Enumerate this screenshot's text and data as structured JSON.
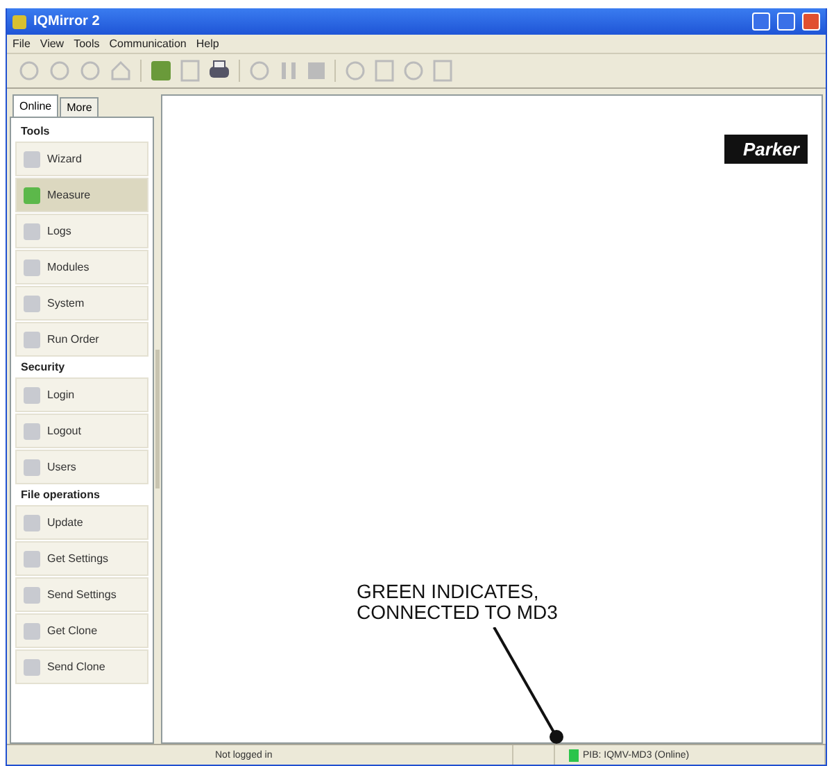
{
  "window": {
    "title": "IQMirror 2"
  },
  "menu": [
    "File",
    "View",
    "Tools",
    "Communication",
    "Help"
  ],
  "toolbar": [
    {
      "kind": "circle",
      "enabled": false
    },
    {
      "kind": "circle",
      "enabled": false
    },
    {
      "kind": "circle",
      "enabled": false
    },
    {
      "kind": "house",
      "enabled": false
    },
    {
      "kind": "sep"
    },
    {
      "kind": "chip",
      "enabled": true
    },
    {
      "kind": "page",
      "enabled": false
    },
    {
      "kind": "printer",
      "enabled": true
    },
    {
      "kind": "sep"
    },
    {
      "kind": "circle",
      "enabled": false
    },
    {
      "kind": "bars",
      "enabled": false
    },
    {
      "kind": "block",
      "enabled": false
    },
    {
      "kind": "sep"
    },
    {
      "kind": "circle",
      "enabled": false
    },
    {
      "kind": "page",
      "enabled": false
    },
    {
      "kind": "circle",
      "enabled": false
    },
    {
      "kind": "page",
      "enabled": false
    }
  ],
  "tabs": [
    {
      "label": "Online",
      "selected": true
    },
    {
      "label": "More",
      "selected": false
    }
  ],
  "sections": [
    {
      "title": "Tools",
      "items": [
        {
          "label": "Wizard",
          "selected": false
        },
        {
          "label": "Measure",
          "selected": true
        },
        {
          "label": "Logs",
          "selected": false
        },
        {
          "label": "Modules",
          "selected": false
        },
        {
          "label": "System",
          "selected": false
        },
        {
          "label": "Run Order",
          "selected": false
        }
      ]
    },
    {
      "title": "Security",
      "items": [
        {
          "label": "Login",
          "selected": false
        },
        {
          "label": "Logout",
          "selected": false
        },
        {
          "label": "Users",
          "selected": false
        }
      ]
    },
    {
      "title": "File operations",
      "items": [
        {
          "label": "Update",
          "selected": false
        },
        {
          "label": "Get Settings",
          "selected": false
        },
        {
          "label": "Send Settings",
          "selected": false
        },
        {
          "label": "Get Clone",
          "selected": false
        },
        {
          "label": "Send Clone",
          "selected": false
        }
      ]
    }
  ],
  "logo": "Parker",
  "annotation": {
    "lines": [
      "GREEN INDICATES,",
      "CONNECTED TO MD3"
    ]
  },
  "status_bar": {
    "login": "Not logged in",
    "connection": {
      "text": "PIB: IQMV-MD3 (Online)",
      "connected": true
    }
  }
}
